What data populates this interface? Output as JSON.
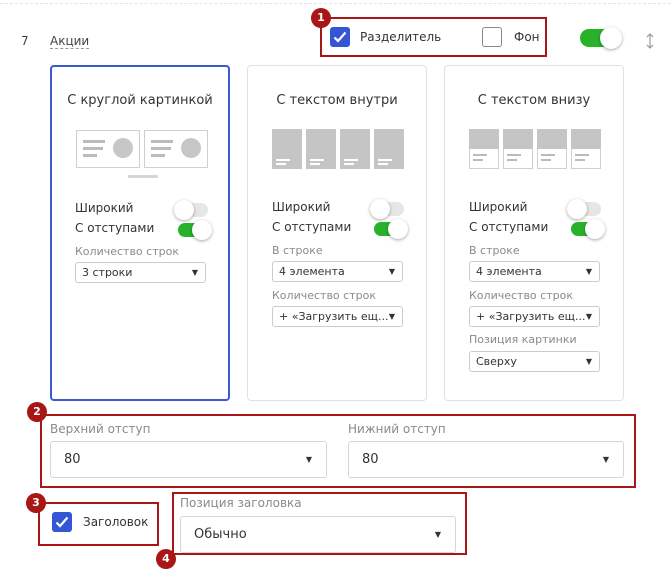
{
  "row": {
    "number": "7",
    "title": "Акции"
  },
  "header_options": {
    "divider": {
      "label": "Разделитель",
      "checked": true
    },
    "background": {
      "label": "Фон",
      "checked": false
    },
    "enabled": true
  },
  "cards": [
    {
      "title": "С круглой картинкой",
      "selected": true,
      "wide_label": "Широкий",
      "wide_on": false,
      "padding_label": "С отступами",
      "padding_on": true,
      "rows_label": "Количество строк",
      "rows_value": "3 строки"
    },
    {
      "title": "С текстом внутри",
      "selected": false,
      "wide_label": "Широкий",
      "wide_on": false,
      "padding_label": "С отступами",
      "padding_on": true,
      "per_row_label": "В строке",
      "per_row_value": "4 элемента",
      "rows_label": "Количество строк",
      "rows_value": "+ «Загрузить ещ..."
    },
    {
      "title": "С текстом внизу",
      "selected": false,
      "wide_label": "Широкий",
      "wide_on": false,
      "padding_label": "С отступами",
      "padding_on": true,
      "per_row_label": "В строке",
      "per_row_value": "4 элемента",
      "rows_label": "Количество строк",
      "rows_value": "+ «Загрузить ещ...",
      "image_pos_label": "Позиция картинки",
      "image_pos_value": "Сверху"
    }
  ],
  "spacing": {
    "top_label": "Верхний отступ",
    "top_value": "80",
    "bottom_label": "Нижний отступ",
    "bottom_value": "80"
  },
  "heading": {
    "label": "Заголовок",
    "checked": true,
    "position_label": "Позиция заголовка",
    "position_value": "Обычно"
  },
  "annotations": [
    "1",
    "2",
    "3",
    "4"
  ],
  "colors": {
    "accent": "#3355d6",
    "toggle_on": "#27b22a",
    "annotation": "#a81616"
  }
}
